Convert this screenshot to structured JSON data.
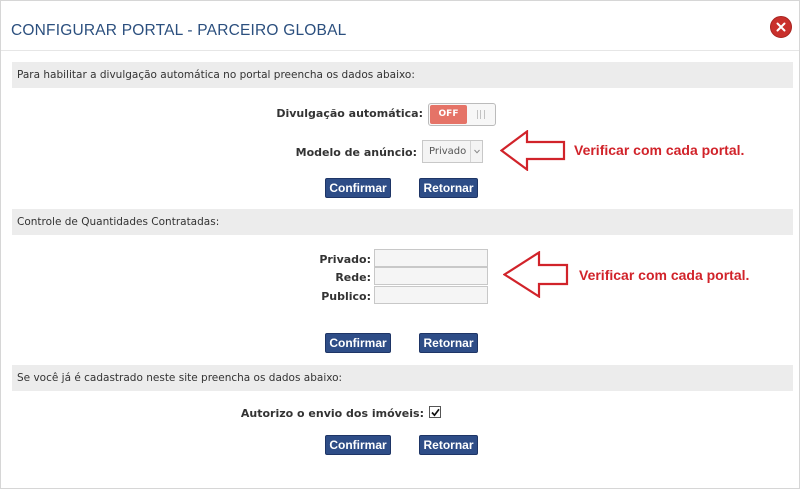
{
  "dialog": {
    "title": "CONFIGURAR PORTAL - PARCEIRO GLOBAL",
    "close_icon": "close-icon",
    "close_color": "#c9302c"
  },
  "section1": {
    "header": "Para habilitar a divulgação automática no portal preencha os dados abaixo:",
    "auto_label": "Divulgação automática:",
    "toggle_state": "OFF",
    "model_label": "Modelo de anúncio:",
    "model_value": "Privado",
    "confirm_label": "Confirmar",
    "back_label": "Retornar",
    "annotation": "Verificar com cada portal."
  },
  "section2": {
    "header": "Controle de Quantidades Contratadas:",
    "privado_label": "Privado:",
    "privado_value": "",
    "rede_label": "Rede:",
    "rede_value": "",
    "publico_label": "Publico:",
    "publico_value": "",
    "confirm_label": "Confirmar",
    "back_label": "Retornar",
    "annotation": "Verificar com cada portal."
  },
  "section3": {
    "header": "Se você já é cadastrado neste site preencha os dados abaixo:",
    "consent_label": "Autorizo o envio dos imóveis:",
    "consent_checked": true,
    "confirm_label": "Confirmar",
    "back_label": "Retornar"
  },
  "colors": {
    "title": "#2b4f7e",
    "button": "#2e4d87",
    "toggle_off": "#e57367",
    "annotation": "#d1232a",
    "section_bar": "#ececec"
  }
}
